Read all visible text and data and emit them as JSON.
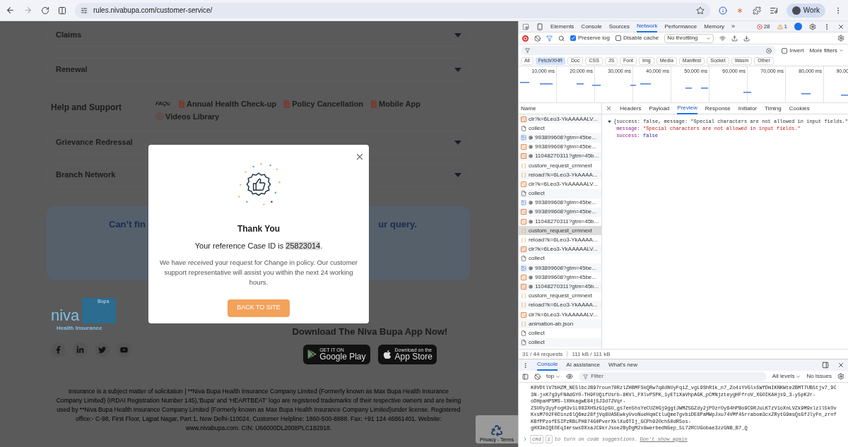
{
  "browser": {
    "url": "rules.nivabupa.com/customer-service/",
    "profile": "Work"
  },
  "page": {
    "accordions_top": [
      {
        "label": "Claims"
      },
      {
        "label": "Renewal"
      }
    ],
    "help": {
      "title": "Help and Support",
      "faqs_label": "FAQs:",
      "links": [
        {
          "label": "Annual Health Check-up",
          "kind": "pdf"
        },
        {
          "label": "Policy Cancellation",
          "kind": "pdf"
        },
        {
          "label": "Mobile App",
          "kind": "pdf"
        },
        {
          "label": "Videos Library",
          "kind": "video"
        }
      ]
    },
    "accordions_bottom": [
      {
        "label": "Grievance Redressal"
      },
      {
        "label": "Branch Network"
      }
    ],
    "query_card": {
      "text_left": "Can’t fin",
      "text_right": "ur query."
    },
    "logo": {
      "wordmark": "niva",
      "partner": "Bupa",
      "tagline": "Health Insurance"
    },
    "app_section": {
      "title": "Download The Niva Bupa App Now!",
      "stores": [
        {
          "kind": "google",
          "small": "GET IT ON",
          "big": "Google Play"
        },
        {
          "kind": "apple",
          "small": "Download on the",
          "big": "App Store"
        }
      ]
    },
    "footer_text": "Insurance is a subject matter of solicitation | **Niva Bupa Health Insurance Company Limited (Formerly known as Max Bupa Health Insurance Company Limited) (IRDAI Registration Number 145),‘Bupa’ and ‘HEARTBEAT’ logo are registered trademarks of their respective owners and are being used by **Niva Bupa Health Insurance Company Limited (Formerly known as Max Bupa Health Insurance Company Limited)under license. Registered office:- C-98, First Floor, Lajpat Nagar, Part 1, New Delhi-110024, Customer Helpline: 1860-500-8888. Fax: +91 124 46861401. Website: www.nivabupa.com. CIN: U66000DL2008PLC182918.",
    "recaptcha": "Privacy - Terms"
  },
  "modal": {
    "title": "Thank You",
    "reference_prefix": "Your reference Case ID is",
    "case_id": "25823014",
    "reference_suffix": ".",
    "body": "We have received your request for Change in policy. Our customer support representative will assist you within the next 24 working hours.",
    "button": "BACK TO SITE"
  },
  "devtools": {
    "tabs": [
      {
        "label": "Elements",
        "selected": false
      },
      {
        "label": "Console",
        "selected": false
      },
      {
        "label": "Sources",
        "selected": false
      },
      {
        "label": "Network",
        "selected": true
      },
      {
        "label": "Performance",
        "selected": false
      },
      {
        "label": "Memory",
        "selected": false
      }
    ],
    "more_tabs": "»",
    "errors": "28",
    "warnings": "1",
    "preserve_log": {
      "label": "Preserve log",
      "checked": true
    },
    "disable_cache": {
      "label": "Disable cache",
      "checked": false
    },
    "throttling": "No throttling",
    "invert": {
      "label": "Invert",
      "checked": false
    },
    "more_filters": "More filters",
    "type_filters": [
      {
        "label": "All",
        "selected": false
      },
      {
        "label": "Fetch/XHR",
        "selected": true
      },
      {
        "label": "Doc",
        "selected": false
      },
      {
        "label": "CSS",
        "selected": false
      },
      {
        "label": "JS",
        "selected": false
      },
      {
        "label": "Font",
        "selected": false
      },
      {
        "label": "Img",
        "selected": false
      },
      {
        "label": "Media",
        "selected": false
      },
      {
        "label": "Manifest",
        "selected": false
      },
      {
        "label": "Socket",
        "selected": false
      },
      {
        "label": "Wasm",
        "selected": false
      },
      {
        "label": "Other",
        "selected": false
      }
    ],
    "timeline_ticks": [
      "10,000 ms",
      "20,000 ms",
      "30,000 ms",
      "40,000 ms",
      "50,000 ms",
      "60,000 ms",
      "70,000 ms",
      "80,000 ms",
      "90,00"
    ],
    "name_header": "Name",
    "requests": [
      {
        "name": "clr?k=6Leo3-YkAAAAALV...",
        "kind": "xhr",
        "gear": false,
        "selected": false
      },
      {
        "name": "collect",
        "kind": "doc",
        "gear": false,
        "selected": false
      },
      {
        "name": "993899608?gtm=45be...",
        "kind": "img",
        "gear": true,
        "selected": false
      },
      {
        "name": "993899608?gtm=45be...",
        "kind": "xhr",
        "gear": true,
        "selected": false
      },
      {
        "name": "11048270311?gtm=45b...",
        "kind": "xhr",
        "gear": true,
        "selected": false
      },
      {
        "name": "custom_request_crmnext",
        "kind": "fetch",
        "gear": false,
        "selected": false
      },
      {
        "name": "reload?k=6Leo3-YkAAAA...",
        "kind": "fetch",
        "gear": false,
        "selected": false
      },
      {
        "name": "clr?k=6Leo3-YkAAAAALV...",
        "kind": "xhr",
        "gear": false,
        "selected": false
      },
      {
        "name": "collect",
        "kind": "doc",
        "gear": false,
        "selected": false
      },
      {
        "name": "993899608?gtm=45be...",
        "kind": "img",
        "gear": true,
        "selected": false
      },
      {
        "name": "993899608?gtm=45be...",
        "kind": "xhr",
        "gear": true,
        "selected": false
      },
      {
        "name": "11048270311?gtm=45b...",
        "kind": "xhr",
        "gear": true,
        "selected": false
      },
      {
        "name": "custom_request_crmnext",
        "kind": "fetch",
        "gear": false,
        "selected": true
      },
      {
        "name": "reload?k=6Leo3-YkAAAA...",
        "kind": "fetch",
        "gear": false,
        "selected": false
      },
      {
        "name": "clr?k=6Leo3-YkAAAAALV...",
        "kind": "xhr",
        "gear": false,
        "selected": false
      },
      {
        "name": "collect",
        "kind": "doc",
        "gear": false,
        "selected": false
      },
      {
        "name": "993899608?gtm=45be...",
        "kind": "img",
        "gear": true,
        "selected": false
      },
      {
        "name": "993899608?gtm=45be...",
        "kind": "xhr",
        "gear": true,
        "selected": false
      },
      {
        "name": "11048270311?gtm=45b...",
        "kind": "xhr",
        "gear": true,
        "selected": false
      },
      {
        "name": "custom_request_crmnext",
        "kind": "fetch",
        "gear": false,
        "selected": false
      },
      {
        "name": "reload?k=6Leo3-YkAAAA...",
        "kind": "fetch",
        "gear": false,
        "selected": false
      },
      {
        "name": "clr?k=6Leo3-YkAAAAALV...",
        "kind": "xhr",
        "gear": false,
        "selected": false
      },
      {
        "name": "animation-ab.json",
        "kind": "fetch",
        "gear": false,
        "selected": false
      },
      {
        "name": "collect",
        "kind": "doc",
        "gear": false,
        "selected": false
      },
      {
        "name": "collect",
        "kind": "doc",
        "gear": false,
        "selected": false
      }
    ],
    "summary_requests": "31 / 44 requests",
    "summary_size": "111 kB / 111 kB",
    "detail_tabs": [
      {
        "label": "Headers",
        "selected": false
      },
      {
        "label": "Payload",
        "selected": false
      },
      {
        "label": "Preview",
        "selected": true
      },
      {
        "label": "Response",
        "selected": false
      },
      {
        "label": "Initiator",
        "selected": false
      },
      {
        "label": "Timing",
        "selected": false
      },
      {
        "label": "Cookies",
        "selected": false
      }
    ],
    "preview": {
      "summary": "{success: false, message: \"Special characters are not allowed in input fields.\"",
      "expanded": true,
      "properties": [
        {
          "key": "message:",
          "value": "\"Special characters are not allowed in input fields.\"",
          "kind": "string"
        },
        {
          "key": "success:",
          "value": "false",
          "kind": "boolean"
        }
      ]
    },
    "drawer_tabs": [
      {
        "label": "Console",
        "selected": true
      },
      {
        "label": "AI assistance",
        "selected": false
      },
      {
        "label": "What's new",
        "selected": false
      }
    ],
    "context": "top",
    "filter_placeholder": "Filter",
    "levels": "All levels",
    "issues": "No Issues",
    "console_lines": [
      "K0VDtlV7bHZM_NE5lbcJB97roun70RzlZHBMFSkQRw7q8dNUyFqiZ_vgL9ShR1k_n7_Zo4iYVGlx5WfDmIKNKWte2BMT7UB5tjv7_9C",
      "3N-jxK7g3yFNAdGYO-TH9FUQifUsrb-8KVl_FXlvPSPK_1yETiXaVhpAGK_pCMNjzteygHFfroV_XGOIKAHjs9_3-y5pK2r-",
      "oDHpaHPSMS-lXHkagwE84j5J3d72Vqr-",
      "ZSUOy3yyFogH3v1L083XHSzG1pGU_gs7en5hsYeCUZHGj9ggtJWMZ5GZdy2jPOzrOy64hPBo9C9RJuLKTzV1oXnLVZk9M9xlzll5kOv",
      "KxsM702F0Dinz6lQ6mz28fjVq8UASEwkyUvoNueHqmCtluQme7gvbiDE8PaMWpJxu74VMf45rrabom3cxZRytG9msQsGfJlyFn_zrnf",
      "KBfPPzofE5IPzRBLPH874G0PverXklXu6TIj_GCPh92Och50dR5os-",
      "gHX3mIQEOEqImrswsDXxaJC9krJsoe2ByDgM2x8werbedNGep_5L72RCUGobae3zzGNB_B7_Q"
    ],
    "prompt": {
      "key1": "cmd",
      "key2": "i",
      "hint": "to turn on code suggestions.",
      "link": "Don't show again"
    }
  }
}
